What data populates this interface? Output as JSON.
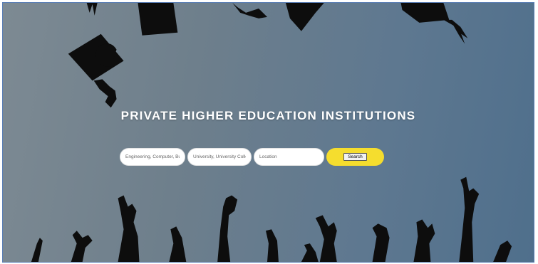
{
  "hero": {
    "title": "PRIVATE HIGHER EDUCATION INSTITUTIONS",
    "background_colors": [
      "#7d8a93",
      "#4f6f8c"
    ]
  },
  "search": {
    "field_subject_placeholder": "Engineering, Computer, Bu",
    "field_type_placeholder": "University, University Colleg",
    "field_location_placeholder": "Location",
    "button_label": "Search",
    "button_container_color": "#f5dd2e"
  }
}
